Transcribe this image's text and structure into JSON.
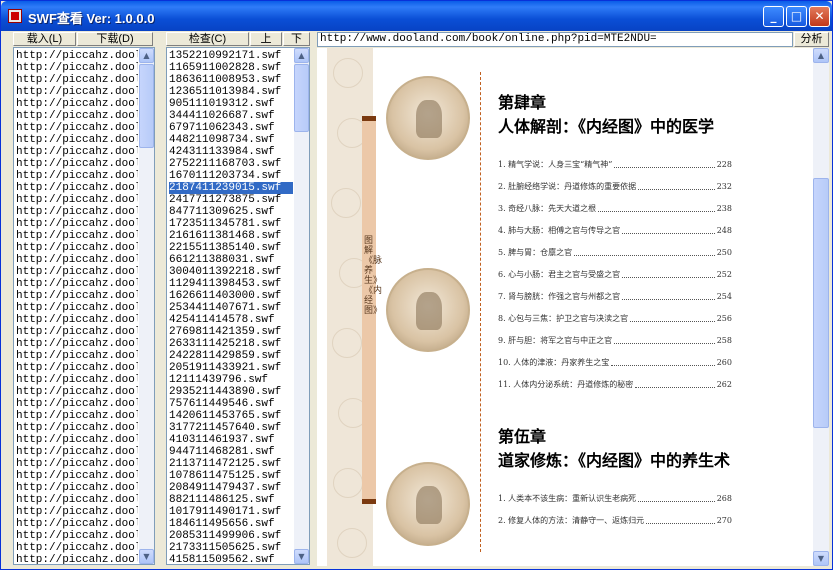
{
  "window": {
    "title": "SWF查看 Ver: 1.0.0.0"
  },
  "titlebar": {
    "min": "_",
    "max": "□",
    "close": "✕"
  },
  "toolbar": {
    "load": "载入(L)",
    "download": "下载(D)",
    "check": "检查(C)",
    "up": "上",
    "down": "下",
    "analyze": "分析"
  },
  "url": "http://www.dooland.com/book/online.php?pid=MTE2NDU=",
  "left_rows": [
    "http://piccahz.doolan",
    "http://piccahz.doolan",
    "http://piccahz.doolan",
    "http://piccahz.doolan",
    "http://piccahz.doolan",
    "http://piccahz.doolan",
    "http://piccahz.doolan",
    "http://piccahz.doolan",
    "http://piccahz.doolan",
    "http://piccahz.doolan",
    "http://piccahz.doolan",
    "http://piccahz.doolan",
    "http://piccahz.doolan",
    "http://piccahz.doolan",
    "http://piccahz.doolan",
    "http://piccahz.doolan",
    "http://piccahz.doolan",
    "http://piccahz.doolan",
    "http://piccahz.doolan",
    "http://piccahz.doolan",
    "http://piccahz.doolan",
    "http://piccahz.doolan",
    "http://piccahz.doolan",
    "http://piccahz.doolan",
    "http://piccahz.doolan",
    "http://piccahz.doolan",
    "http://piccahz.doolan",
    "http://piccahz.doolan",
    "http://piccahz.doolan",
    "http://piccahz.doolan",
    "http://piccahz.doolan",
    "http://piccahz.doolan",
    "http://piccahz.doolan",
    "http://piccahz.doolan",
    "http://piccahz.doolan",
    "http://piccahz.doolan",
    "http://piccahz.doolan",
    "http://piccahz.doolan",
    "http://piccahz.doolan",
    "http://piccahz.doolan",
    "http://piccahz.doolan",
    "http://piccahz.doolan",
    "http://piccahz.doolan"
  ],
  "mid_rows": [
    "1352210992171.swf",
    "1165911002828.swf",
    "1863611008953.swf",
    "1236511013984.swf",
    "905111019312.swf",
    "344411026687.swf",
    "679711062343.swf",
    "448211098734.swf",
    "424311133984.swf",
    "2752211168703.swf",
    "1670111203734.swf",
    "2187411239015.swf",
    "2417711273875.swf",
    "847711309625.swf",
    "1723511345781.swf",
    "2161611381468.swf",
    "2215511385140.swf",
    "661211388031.swf",
    "3004011392218.swf",
    "1129411398453.swf",
    "1626611403000.swf",
    "2534411407671.swf",
    "425411414578.swf",
    "2769811421359.swf",
    "2633111425218.swf",
    "2422811429859.swf",
    "2051911433921.swf",
    "12111439796.swf",
    "2935211443890.swf",
    "757611449546.swf",
    "1420611453765.swf",
    "3177211457640.swf",
    "410311461937.swf",
    "944711468281.swf",
    "2113711472125.swf",
    "1078611475125.swf",
    "2084911479437.swf",
    "882111486125.swf",
    "1017911490171.swf",
    "184611495656.swf",
    "2085311499906.swf",
    "2173311505625.swf",
    "415811509562.swf"
  ],
  "selected_index": 11,
  "book": {
    "spine": "图解《脉养生》《内经图》",
    "ch4_a": "第肆章",
    "ch4_b": "人体解剖：《内经图》中的医学",
    "ch4_toc": [
      {
        "t": "1. 精气学说：人身三宝“精气神”",
        "p": "228"
      },
      {
        "t": "2. 肚腑经络学说：丹道修炼的重要依据",
        "p": "232"
      },
      {
        "t": "3. 奇经八脉：先天大道之根",
        "p": "238"
      },
      {
        "t": "4. 肺与大肠：相傅之官与传导之官",
        "p": "248"
      },
      {
        "t": "5. 脾与胃：仓廪之官",
        "p": "250"
      },
      {
        "t": "6. 心与小肠：君主之官与受盛之官",
        "p": "252"
      },
      {
        "t": "7. 肾与膀胱：作强之官与州都之官",
        "p": "254"
      },
      {
        "t": "8. 心包与三焦：护卫之官与决渎之官",
        "p": "256"
      },
      {
        "t": "9. 肝与胆：将军之官与中正之官",
        "p": "258"
      },
      {
        "t": "10. 人体的津液：丹家养生之宝",
        "p": "260"
      },
      {
        "t": "11. 人体内分泌系统：丹道修炼的秘密",
        "p": "262"
      }
    ],
    "ch5_a": "第伍章",
    "ch5_b": "道家修炼：《内经图》中的养生术",
    "ch5_toc": [
      {
        "t": "1. 人类本不该生病：重新认识生老病死",
        "p": "268"
      },
      {
        "t": "2. 修复人体的方法：清静守一、返炼归元",
        "p": "270"
      }
    ]
  }
}
